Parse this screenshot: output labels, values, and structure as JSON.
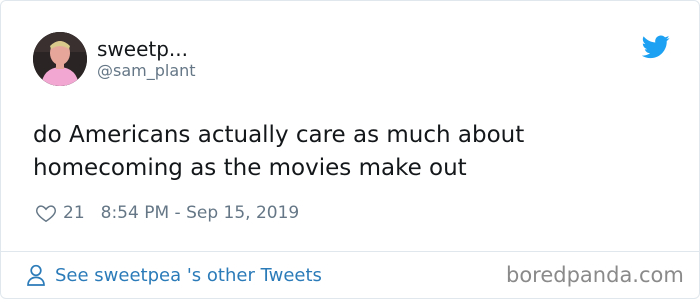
{
  "tweet": {
    "display_name": "sweetp...",
    "handle": "@sam_plant",
    "text": "do Americans actually care as much about homecoming as the movies make out",
    "like_count": "21",
    "timestamp": "8:54 PM - Sep 15, 2019",
    "footer_link": "See sweetpea 's other Tweets"
  },
  "branding": {
    "watermark": "boredpanda.com",
    "bird_icon": "twitter-bird-icon",
    "accent_color": "#1da1f2",
    "link_color": "#2b7bb9"
  }
}
